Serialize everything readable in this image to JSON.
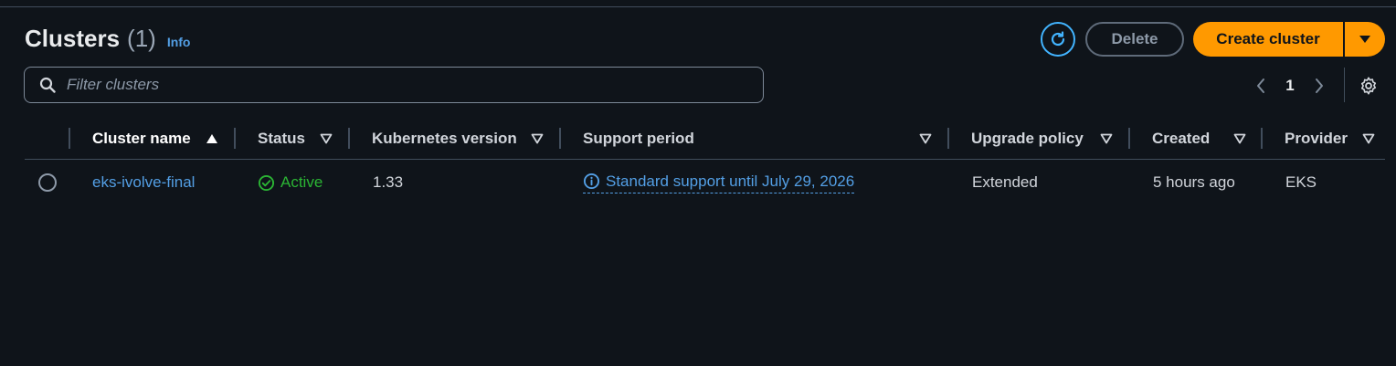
{
  "header": {
    "title": "Clusters",
    "count": "(1)",
    "info_label": "Info"
  },
  "actions": {
    "refresh_icon": "refresh-icon",
    "delete_label": "Delete",
    "create_label": "Create cluster",
    "create_dropdown_icon": "caret-down-icon",
    "accent_color": "#ff9900"
  },
  "filter": {
    "placeholder": "Filter clusters",
    "value": ""
  },
  "pagination": {
    "current_page": "1"
  },
  "table": {
    "columns": [
      {
        "label": "Cluster name",
        "sort": "ascending"
      },
      {
        "label": "Status",
        "sort": "none"
      },
      {
        "label": "Kubernetes version",
        "sort": "none"
      },
      {
        "label": "Support period",
        "sort": "none"
      },
      {
        "label": "Upgrade policy",
        "sort": "none"
      },
      {
        "label": "Created",
        "sort": "none"
      },
      {
        "label": "Provider",
        "sort": "none"
      }
    ],
    "rows": [
      {
        "selected": false,
        "name": "eks-ivolve-final",
        "status": "Active",
        "status_color": "#2bb534",
        "kubernetes_version": "1.33",
        "support_period": "Standard support until July 29, 2026",
        "upgrade_policy": "Extended",
        "created": "5 hours ago",
        "provider": "EKS"
      }
    ]
  }
}
